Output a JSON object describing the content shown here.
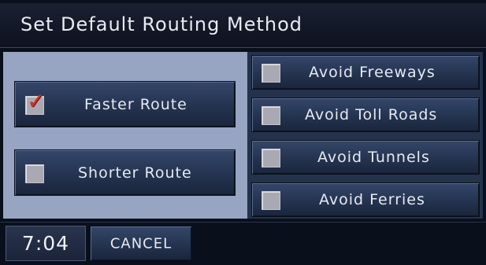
{
  "header": {
    "title": "Set Default Routing Method"
  },
  "route_options": [
    {
      "label": "Faster Route",
      "checked": true
    },
    {
      "label": "Shorter Route",
      "checked": false
    }
  ],
  "avoid_options": [
    {
      "label": "Avoid Freeways",
      "checked": false
    },
    {
      "label": "Avoid Toll Roads",
      "checked": false
    },
    {
      "label": "Avoid Tunnels",
      "checked": false
    },
    {
      "label": "Avoid Ferries",
      "checked": false
    }
  ],
  "footer": {
    "clock": "7:04",
    "cancel_label": "CANCEL"
  },
  "colors": {
    "check": "#d3332b",
    "left_panel": "#97a4c2",
    "button": "#2b3b5a"
  },
  "icons": {
    "checked": "checkmark-icon",
    "unchecked": "empty-checkbox"
  }
}
